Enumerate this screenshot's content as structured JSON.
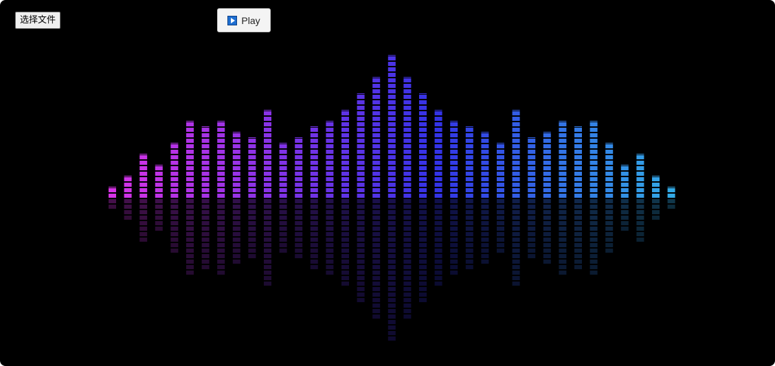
{
  "controls": {
    "file_button_label": "选择文件",
    "play_button_label": "Play",
    "play_icon": "play-icon"
  },
  "visualizer": {
    "bar_levels": [
      2,
      4,
      8,
      6,
      10,
      14,
      13,
      14,
      12,
      11,
      16,
      10,
      11,
      13,
      14,
      16,
      19,
      22,
      26,
      22,
      19,
      16,
      14,
      13,
      12,
      10,
      16,
      11,
      12,
      14,
      13,
      14,
      10,
      6,
      8,
      4,
      2
    ],
    "hue_start": 295,
    "hue_end": 200,
    "background": "#000000"
  }
}
